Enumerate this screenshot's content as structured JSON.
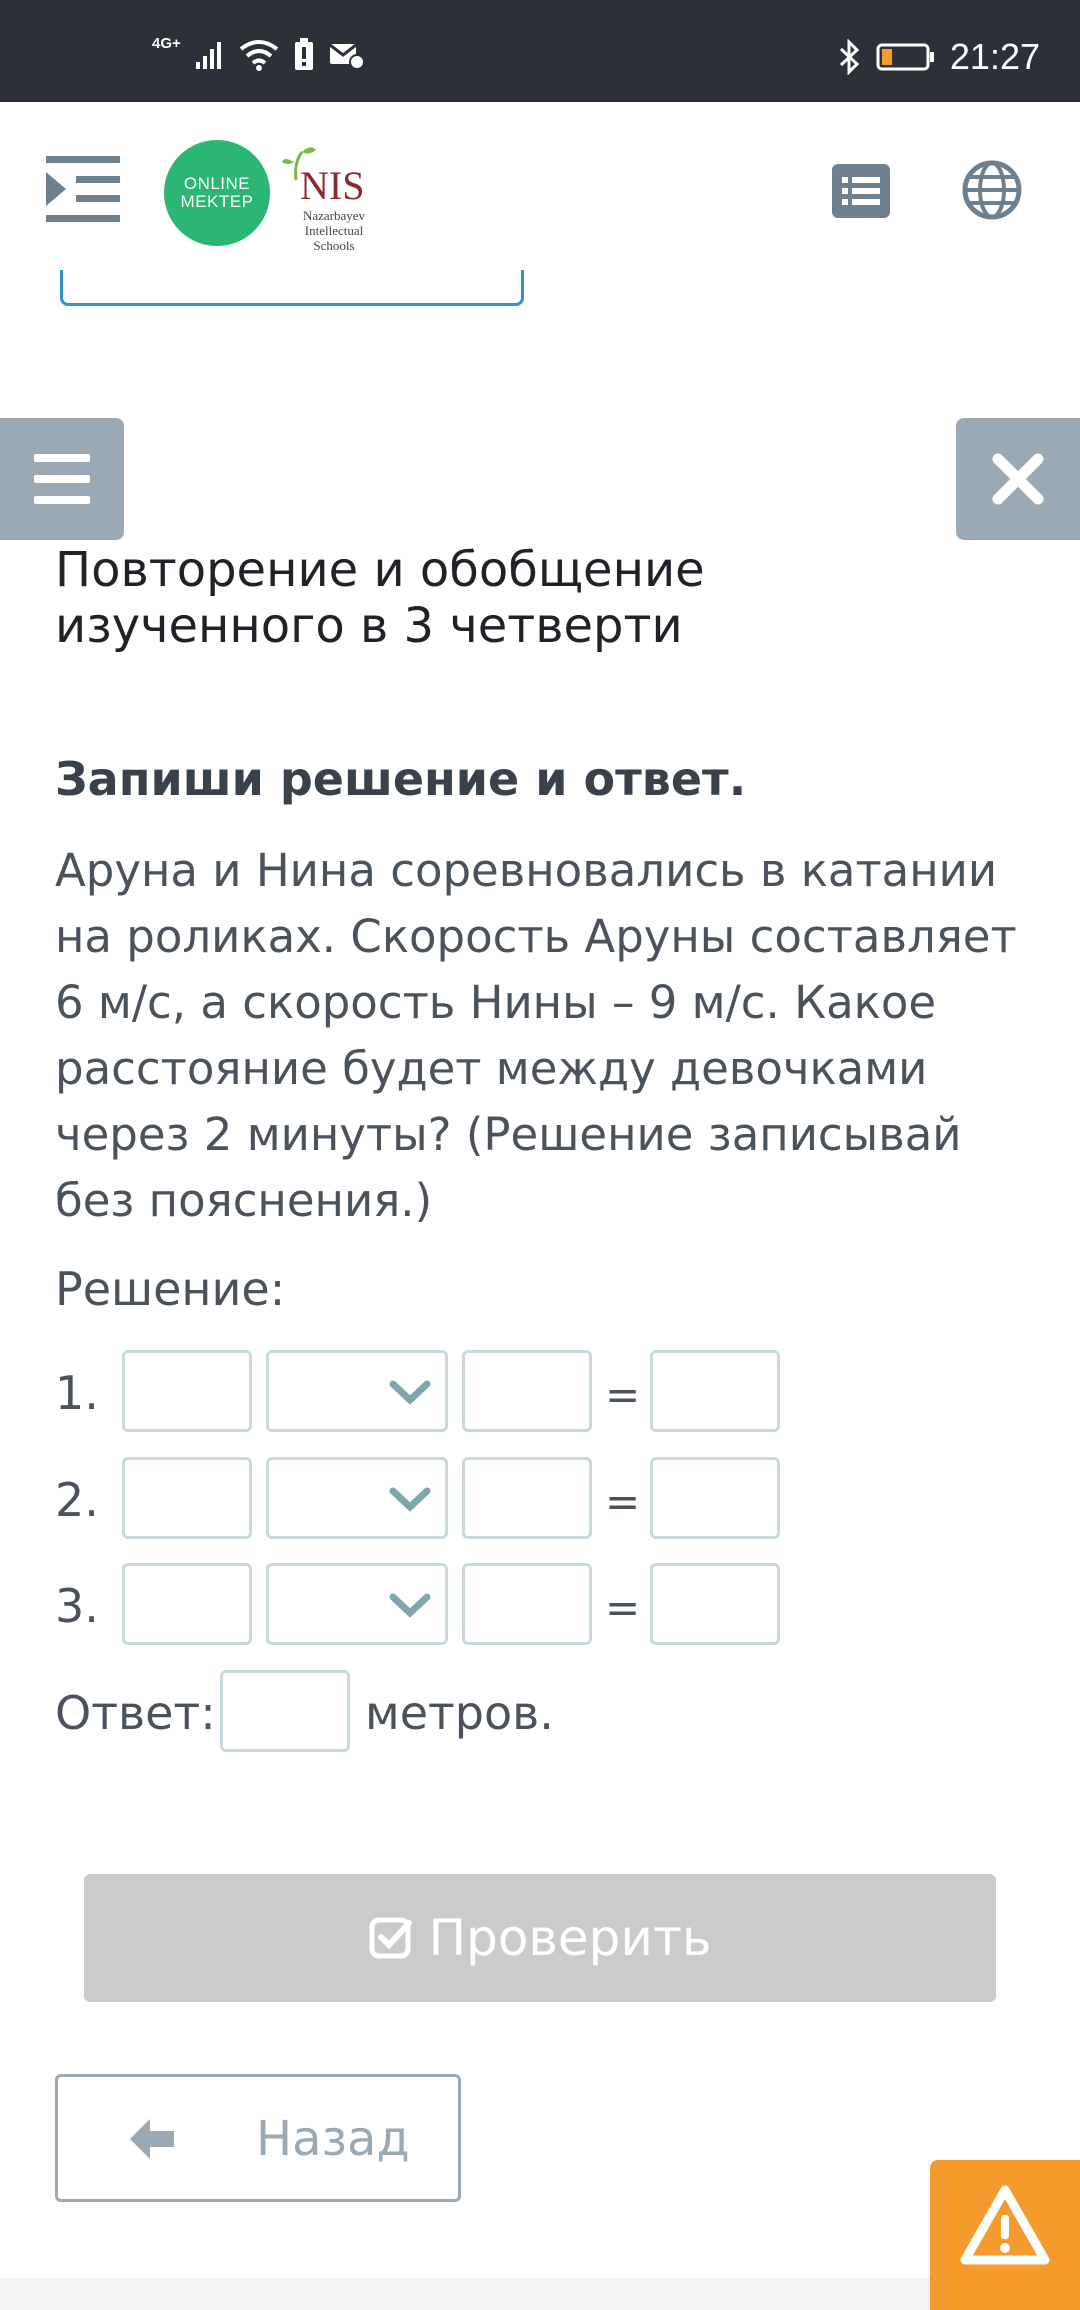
{
  "status_bar": {
    "network": "4G+",
    "time": "21:27"
  },
  "header": {
    "logo_primary_line1": "ONLINE",
    "logo_primary_line2": "MEKTEP",
    "logo_secondary": "NIS",
    "logo_secondary_sub": "Nazarbayev Intellectual Schools"
  },
  "lesson": {
    "title": "Повторение и обобщение изученного в 3 четверти"
  },
  "task": {
    "heading": "Запиши решение и ответ.",
    "text": "Аруна и Нина соревновались в катании на роликах. Скорость Аруны составляет 6 м/с, а скорость Нины – 9 м/с. Какое расстояние будет между девочками через 2 минуты? (Решение записывай без пояснения.)",
    "solution_label": "Решение:",
    "rows": [
      {
        "number": "1.",
        "operand1": "",
        "operator": "",
        "operand2": "",
        "equals": "=",
        "result": ""
      },
      {
        "number": "2.",
        "operand1": "",
        "operator": "",
        "operand2": "",
        "equals": "=",
        "result": ""
      },
      {
        "number": "3.",
        "operand1": "",
        "operator": "",
        "operand2": "",
        "equals": "=",
        "result": ""
      }
    ],
    "answer_label": "Ответ:",
    "answer_value": "",
    "answer_unit": "метров."
  },
  "actions": {
    "check_label": "Проверить",
    "back_label": "Назад"
  },
  "colors": {
    "status_bar": "#2c3038",
    "brand_green": "#2bb673",
    "side_button": "#9aa9b4",
    "check_disabled": "#cbcbcb",
    "warning": "#f59b2d",
    "input_border": "#c6dade"
  },
  "icons": [
    "menu-indent-icon",
    "list-icon",
    "globe-icon",
    "hamburger-icon",
    "close-icon",
    "chevron-down-icon",
    "check-square-icon",
    "arrow-left-icon",
    "warning-icon"
  ]
}
